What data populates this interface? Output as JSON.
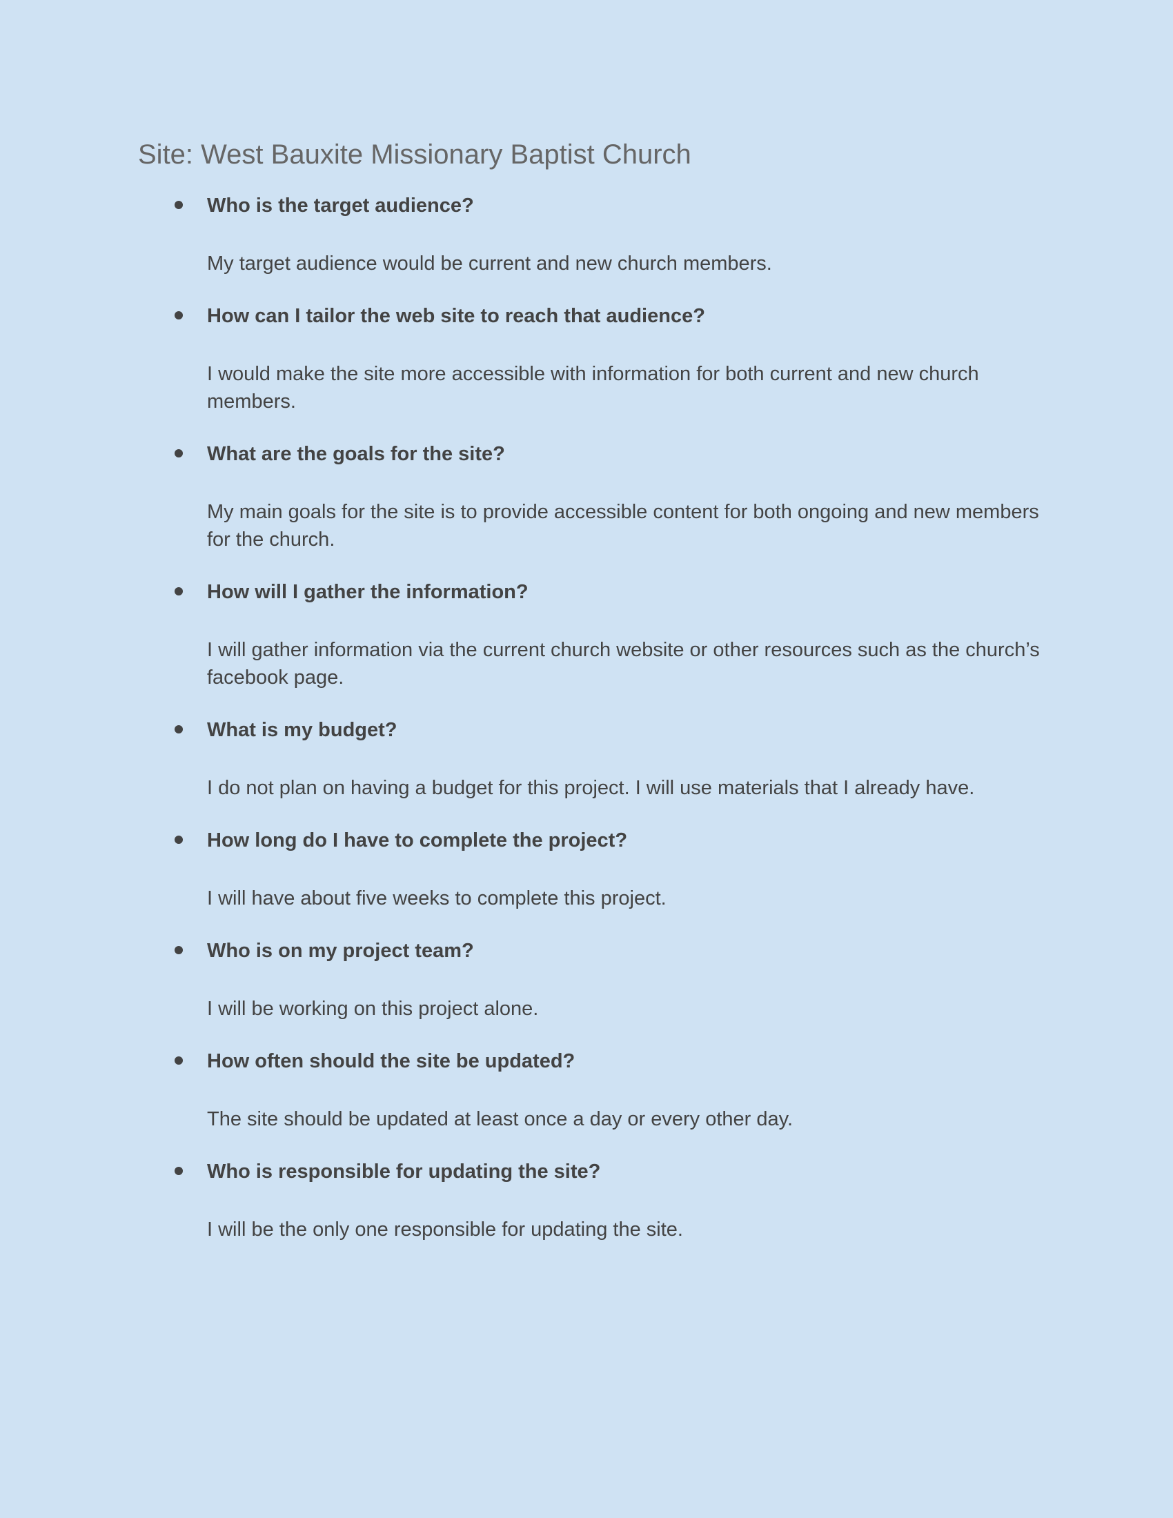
{
  "document": {
    "title": "Site: West Bauxite Missionary Baptist Church"
  },
  "qa": [
    {
      "question": "Who is the target audience?",
      "answer": "My target audience would be current and new church members."
    },
    {
      "question": "How can I tailor the web site to reach that audience?",
      "answer": "I would make the site more accessible with information for both current and new church members."
    },
    {
      "question": "What are the goals for the site?",
      "answer": "My main goals for the site is to provide accessible content for both ongoing and new members for the church."
    },
    {
      "question": "How will I gather the information?",
      "answer": "I will gather information via the current church website or other resources such as the church’s facebook page."
    },
    {
      "question": "What is my budget?",
      "answer": "I do not plan on having a budget for this project. I will use materials that I already have."
    },
    {
      "question": "How long do I have to complete the project?",
      "answer": "I will have about five weeks to complete this project."
    },
    {
      "question": "Who is on my project team?",
      "answer": "I will be working on this project alone."
    },
    {
      "question": "How often should the site be updated?",
      "answer": "The site should be updated at least once a day or every other day."
    },
    {
      "question": "Who is responsible for updating the site?",
      "answer": "I will be the only one responsible for updating the site."
    }
  ],
  "colors": {
    "background": "#cfe2f3",
    "title": "#666666",
    "text": "#434343"
  }
}
